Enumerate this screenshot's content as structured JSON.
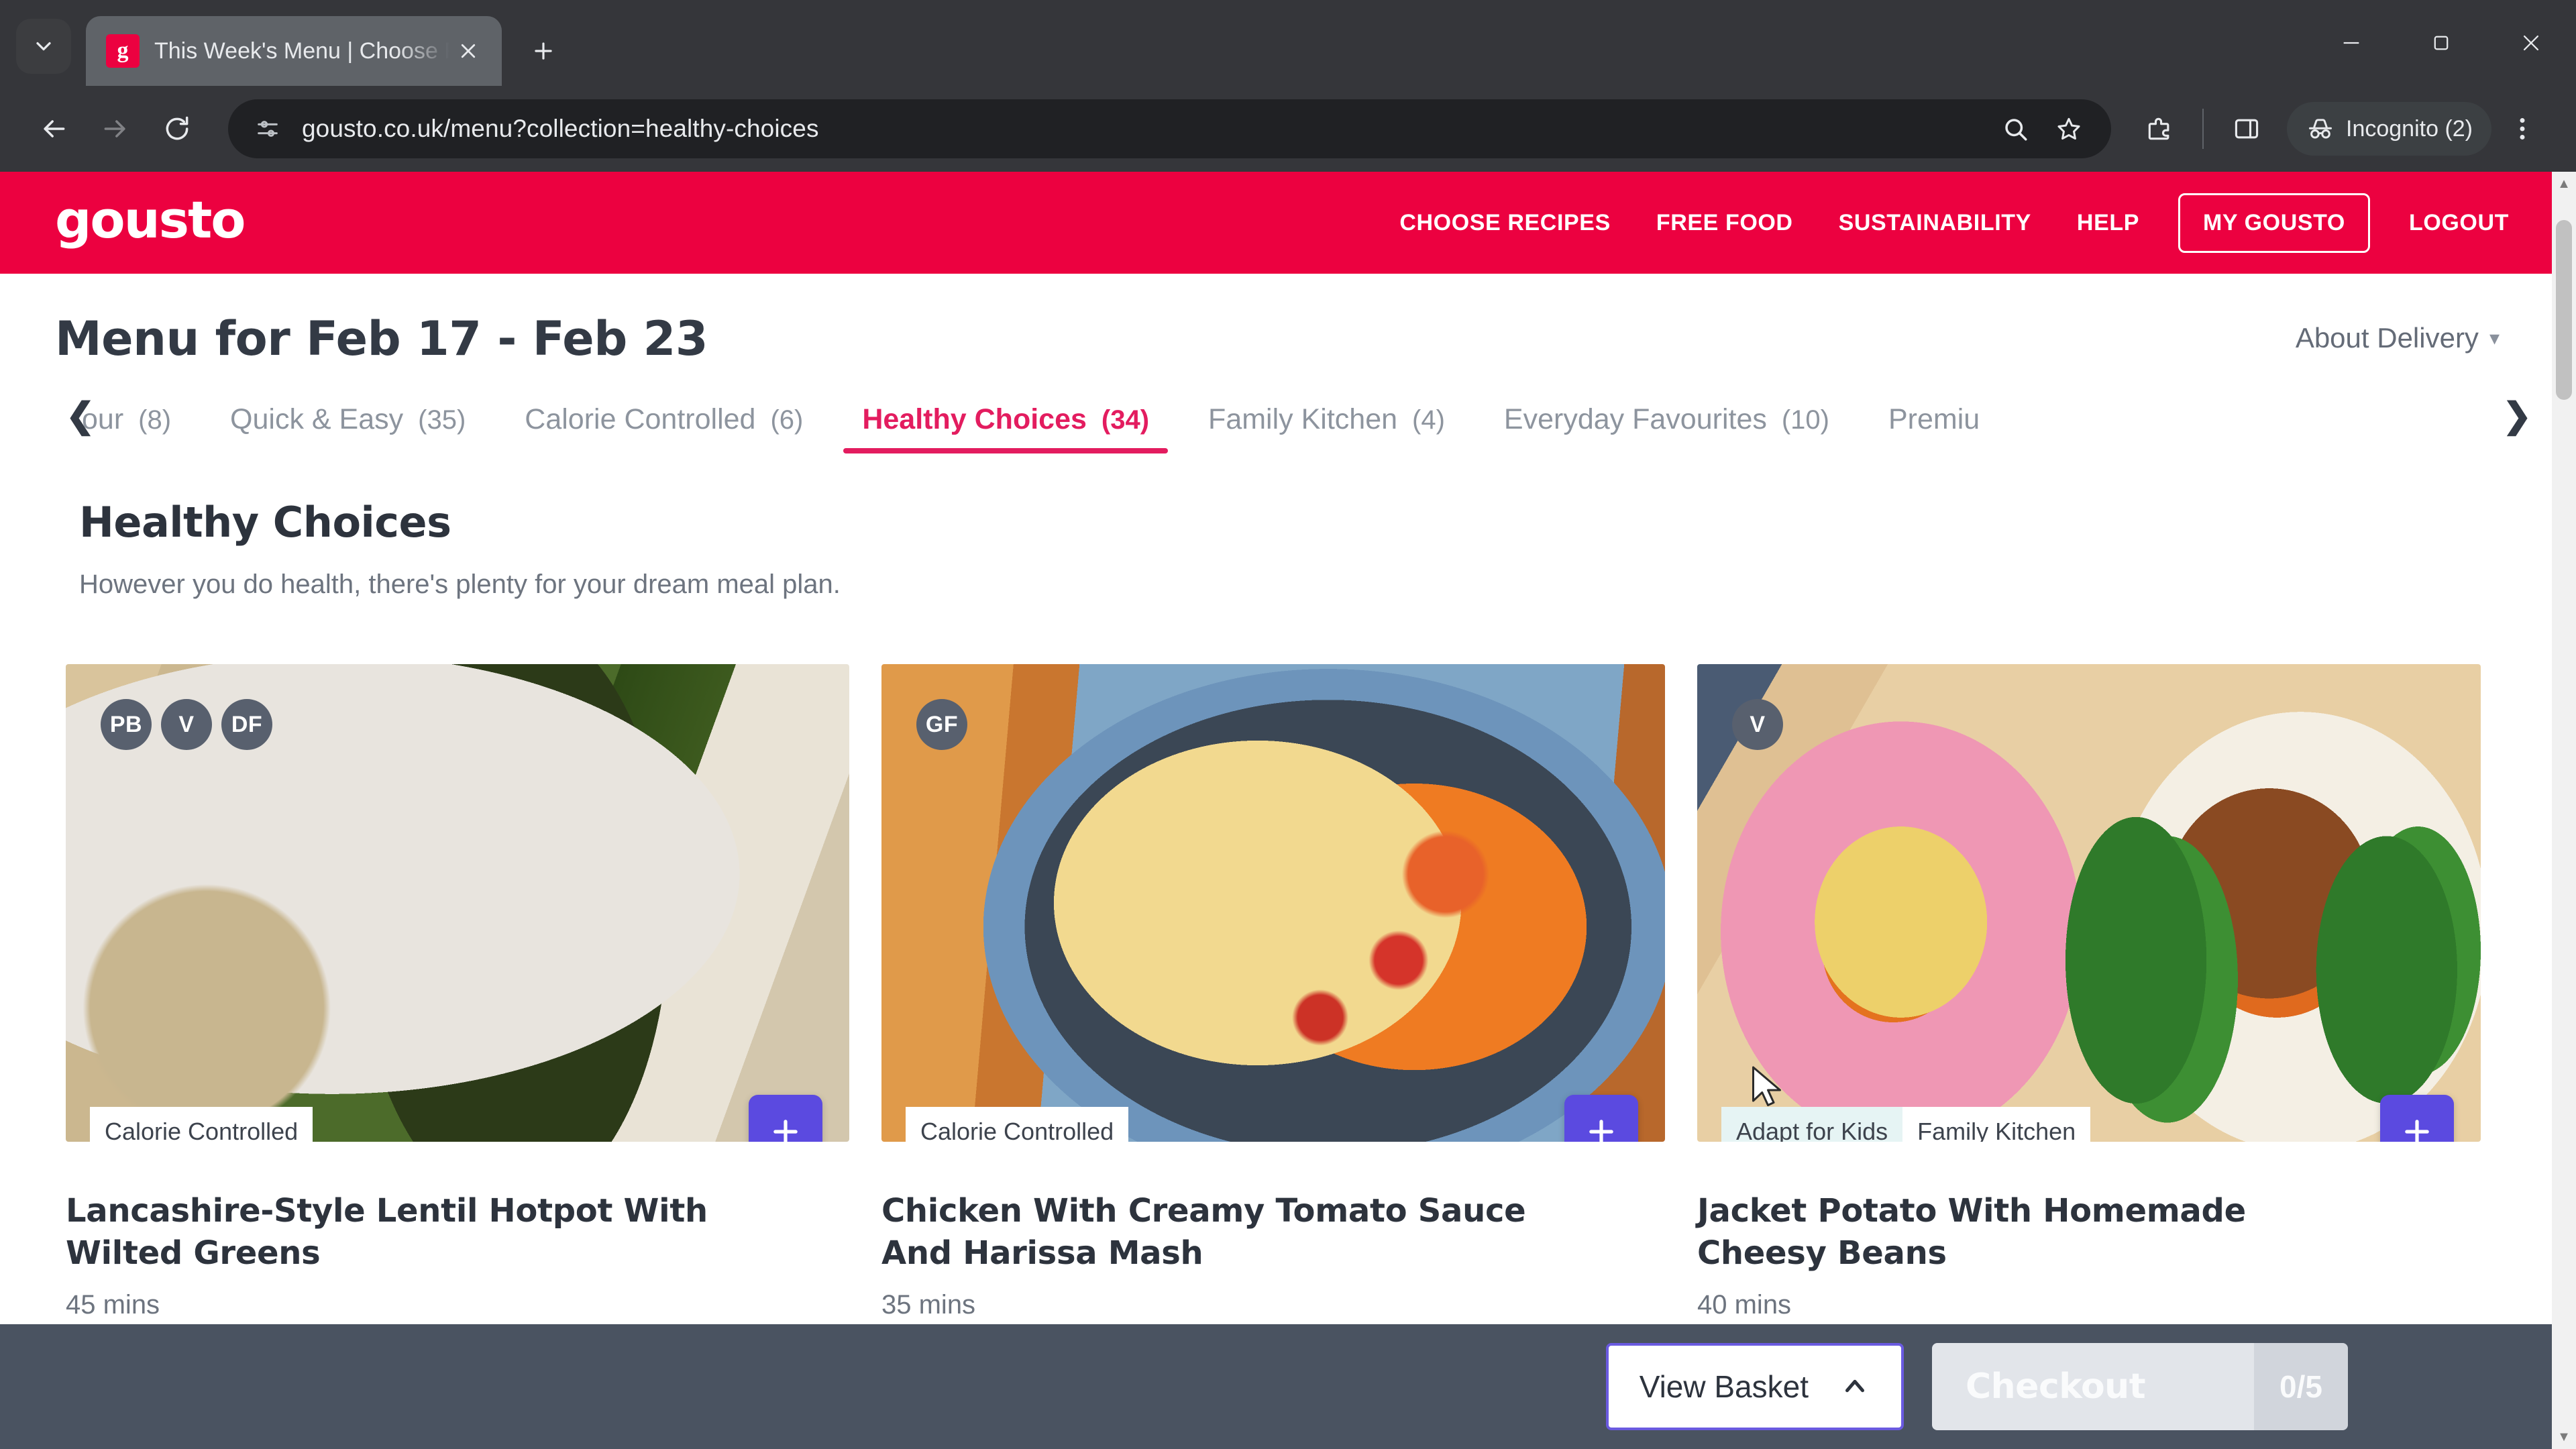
{
  "browser": {
    "tab": {
      "title": "This Week's Menu | Choose Fro",
      "favicon_letter": "g",
      "close_label": "Close tab"
    },
    "new_tab_label": "New Tab",
    "tab_search_label": "Search tabs",
    "window_controls": {
      "minimize": "Minimize",
      "maximize": "Maximize",
      "close": "Close"
    },
    "toolbar": {
      "back": "Back",
      "forward": "Forward",
      "reload": "Reload",
      "url": "gousto.co.uk/menu?collection=healthy-choices",
      "site_info": "View site information",
      "search_label": "Search with Google",
      "bookmark_label": "Bookmark this tab",
      "extensions_label": "Extensions",
      "side_panel_label": "Side panel",
      "incognito_label": "Incognito (2)",
      "menu_label": "Customise and control Google Chrome"
    }
  },
  "site": {
    "logo": "gousto",
    "brand_color": "#EC0140",
    "accent_pink": "#E31C5F",
    "accent_purple": "#5B4AE0",
    "nav": [
      {
        "label": "CHOOSE RECIPES"
      },
      {
        "label": "FREE FOOD"
      },
      {
        "label": "SUSTAINABILITY"
      },
      {
        "label": "HELP"
      },
      {
        "label": "MY GOUSTO"
      },
      {
        "label": "LOGOUT"
      }
    ]
  },
  "menu": {
    "title": "Menu for Feb 17 - Feb 23",
    "about_delivery": "About Delivery",
    "tabs": [
      {
        "label": "our",
        "count": "(8)",
        "active": false,
        "clipped": true
      },
      {
        "label": "Quick & Easy",
        "count": "(35)",
        "active": false,
        "clipped": false
      },
      {
        "label": "Calorie Controlled",
        "count": "(6)",
        "active": false,
        "clipped": false
      },
      {
        "label": "Healthy Choices",
        "count": "(34)",
        "active": true,
        "clipped": false
      },
      {
        "label": "Family Kitchen",
        "count": "(4)",
        "active": false,
        "clipped": false
      },
      {
        "label": "Everyday Favourites",
        "count": "(10)",
        "active": false,
        "clipped": false
      },
      {
        "label": "Premiu",
        "count": "",
        "active": false,
        "clipped": false
      }
    ],
    "tab_scroll_left": "❮",
    "tab_scroll_right": "❯"
  },
  "section": {
    "title": "Healthy Choices",
    "subtitle": "However you do health, there's plenty for your dream meal plan."
  },
  "recipes": [
    {
      "title": "Lancashire-Style Lentil Hotpot With Wilted Greens",
      "time": "45 mins",
      "diet_badges": [
        "PB",
        "V",
        "DF"
      ],
      "tags": [
        {
          "label": "Calorie Controlled",
          "highlight": false
        }
      ],
      "add_label": "+"
    },
    {
      "title": "Chicken With Creamy Tomato Sauce And Harissa Mash",
      "time": "35 mins",
      "diet_badges": [
        "GF"
      ],
      "tags": [
        {
          "label": "Calorie Controlled",
          "highlight": false
        }
      ],
      "add_label": "+"
    },
    {
      "title": "Jacket Potato With Homemade Cheesy Beans",
      "time": "40 mins",
      "diet_badges": [
        "V"
      ],
      "tags": [
        {
          "label": "Adapt for Kids",
          "highlight": true
        },
        {
          "label": "Family Kitchen",
          "highlight": false
        }
      ],
      "add_label": "+"
    }
  ],
  "basket_bar": {
    "view_basket": "View Basket",
    "checkout": "Checkout",
    "checkout_count": "0/5"
  }
}
